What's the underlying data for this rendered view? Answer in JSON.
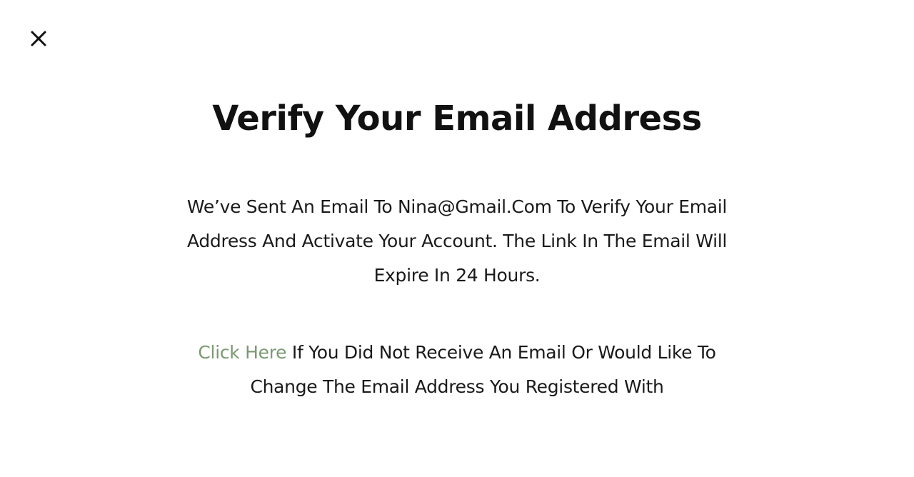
{
  "dialog": {
    "close_icon": "close-icon",
    "title": "Verify Your Email Address",
    "message_line1": "We’ve Sent An Email To Nina@Gmail.Com To Verify Your Email",
    "message_line2": "Address And Activate Your Account. The Link In The Email Will",
    "message_line3": "Expire In 24 Hours.",
    "resend_link_label": "Click Here",
    "resend_text_line1": " If You Did Not Receive An Email Or Would Like To",
    "resend_text_line2": "Change The Email Address You Registered With",
    "link_color": "#7b9a72"
  }
}
